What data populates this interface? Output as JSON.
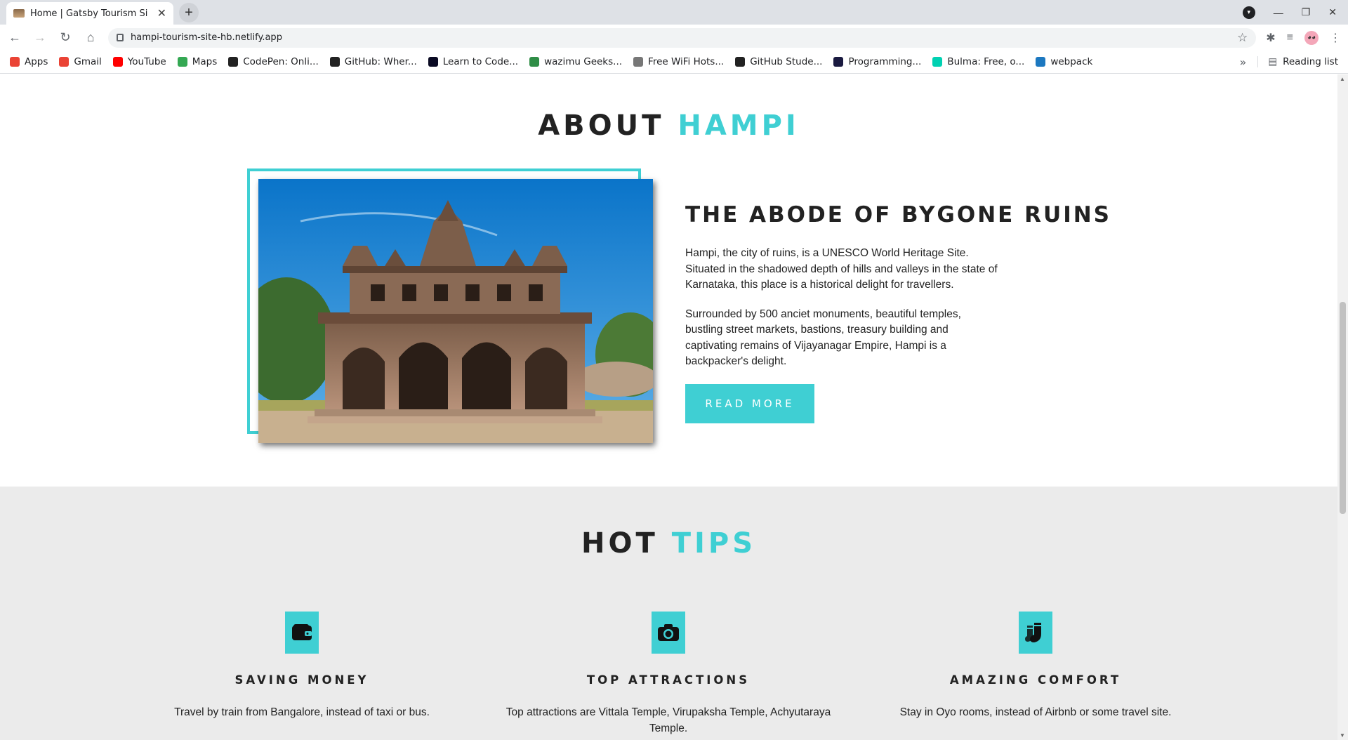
{
  "browser": {
    "tab_title": "Home | Gatsby Tourism Si",
    "url": "hampi-tourism-site-hb.netlify.app",
    "bookmarks": [
      {
        "label": "Apps",
        "icon": "apps-grid-icon",
        "color": "#ea4335"
      },
      {
        "label": "Gmail",
        "icon": "gmail-icon",
        "color": "#ea4335"
      },
      {
        "label": "YouTube",
        "icon": "youtube-icon",
        "color": "#ff0000"
      },
      {
        "label": "Maps",
        "icon": "maps-pin-icon",
        "color": "#34a853"
      },
      {
        "label": "CodePen: Onli...",
        "icon": "codepen-icon",
        "color": "#222222"
      },
      {
        "label": "GitHub: Wher...",
        "icon": "github-icon",
        "color": "#222222"
      },
      {
        "label": "Learn to Code...",
        "icon": "fcc-icon",
        "color": "#0a0a23"
      },
      {
        "label": "wazimu Geeks...",
        "icon": "geeks-icon",
        "color": "#2f8d46"
      },
      {
        "label": "Free WiFi Hots...",
        "icon": "globe-icon",
        "color": "#777777"
      },
      {
        "label": "GitHub Stude...",
        "icon": "github-icon",
        "color": "#222222"
      },
      {
        "label": "Programming...",
        "icon": "hashnode-icon",
        "color": "#1a1a40"
      },
      {
        "label": "Bulma: Free, o...",
        "icon": "bulma-icon",
        "color": "#00d1b2"
      },
      {
        "label": "webpack",
        "icon": "webpack-icon",
        "color": "#1c78c0"
      }
    ],
    "reading_list": "Reading list",
    "overflow": "»"
  },
  "about": {
    "title_main": "ABOUT",
    "title_accent": "HAMPI",
    "heading": "THE ABODE OF BYGONE RUINS",
    "para1": "Hampi, the city of ruins, is a UNESCO World Heritage Site. Situated in the shadowed depth of hills and valleys in the state of Karnataka, this place is a historical delight for travellers.",
    "para2": "Surrounded by 500 anciet monuments, beautiful temples, bustling street markets, bastions, treasury building and captivating remains of Vijayanagar Empire, Hampi is a backpacker's delight.",
    "button": "READ MORE"
  },
  "tips": {
    "title_main": "HOT",
    "title_accent": "TIPS",
    "items": [
      {
        "icon": "wallet-icon",
        "title": "SAVING MONEY",
        "text": "Travel by train from Bangalore, instead of taxi or bus."
      },
      {
        "icon": "camera-icon",
        "title": "TOP ATTRACTIONS",
        "text": "Top attractions are Vittala Temple, Virupaksha Temple, Achyutaraya Temple."
      },
      {
        "icon": "socks-icon",
        "title": "AMAZING COMFORT",
        "text": "Stay in Oyo rooms, instead of Airbnb or some travel site."
      }
    ]
  },
  "colors": {
    "accent": "#3fcfd3",
    "tips_bg": "#ebebeb"
  }
}
